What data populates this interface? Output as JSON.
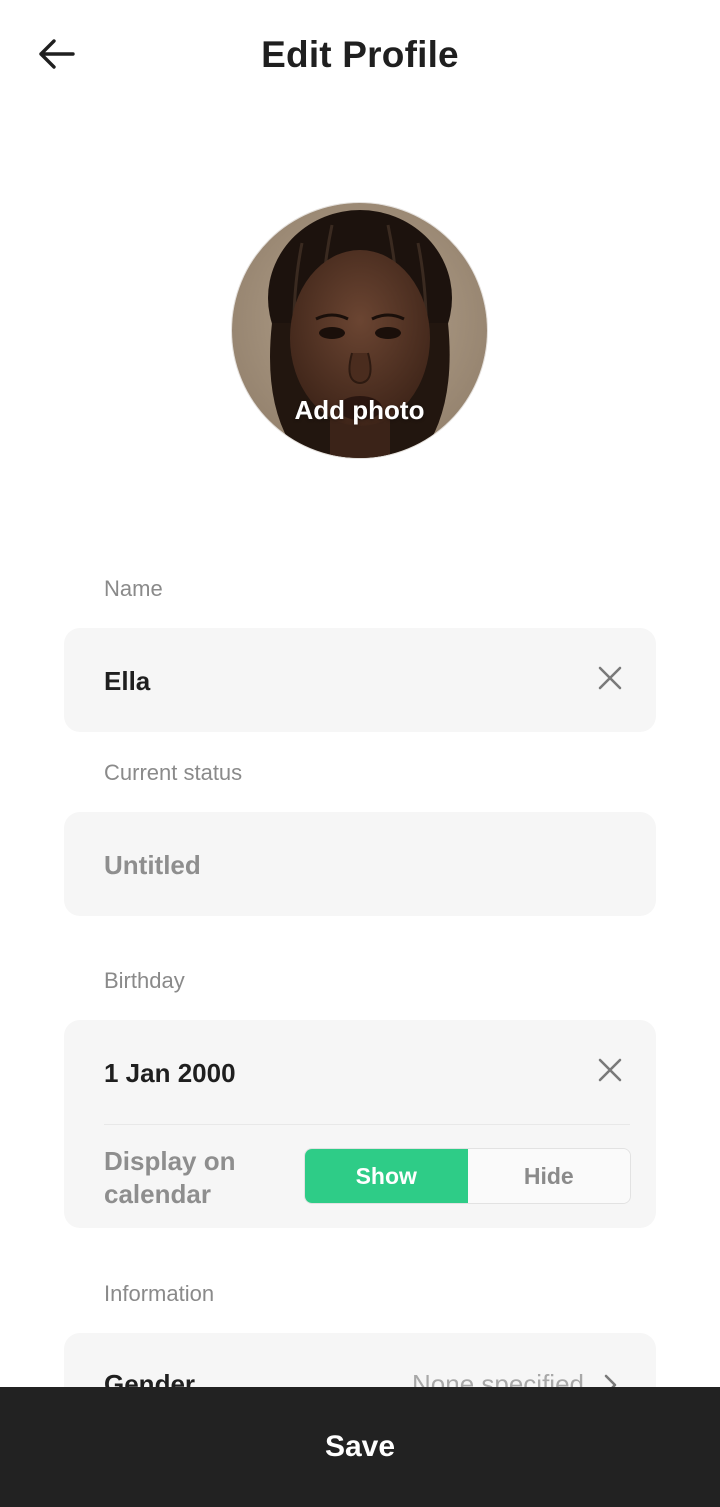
{
  "header": {
    "title": "Edit Profile",
    "back_icon": "arrow-left-icon"
  },
  "avatar": {
    "action_label": "Add photo"
  },
  "name": {
    "label": "Name",
    "value": "Ella",
    "clear_icon": "close-icon"
  },
  "status": {
    "label": "Current status",
    "placeholder": "Untitled"
  },
  "birthday": {
    "label": "Birthday",
    "value": "1 Jan 2000",
    "clear_icon": "close-icon",
    "display_label": "Display on calendar",
    "options": [
      "Show",
      "Hide"
    ],
    "selected": "Show"
  },
  "information": {
    "label": "Information",
    "rows": [
      {
        "key": "Gender",
        "value": "None specified",
        "icon": "chevron-right-icon"
      }
    ]
  },
  "footer": {
    "save_label": "Save"
  },
  "colors": {
    "accent": "#2ecc87",
    "footer_bg": "#222222",
    "card_bg": "#f6f6f6",
    "label_gray": "#8a8a8a"
  }
}
